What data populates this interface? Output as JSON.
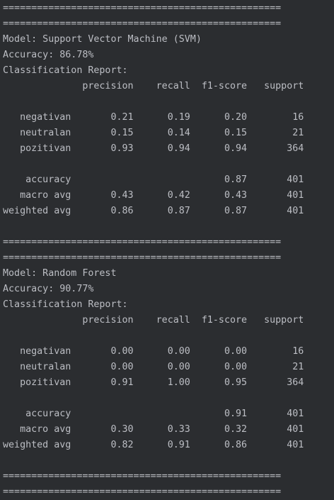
{
  "console": {
    "lines": [
      "=================================================",
      "=================================================",
      "Model: Support Vector Machine (SVM)",
      "Accuracy: 86.78%",
      "Classification Report:",
      "              precision    recall  f1-score   support",
      "",
      "   negativan       0.21      0.19      0.20        16",
      "   neutralan       0.15      0.14      0.15        21",
      "   pozitivan       0.93      0.94      0.94       364",
      "",
      "    accuracy                           0.87       401",
      "   macro avg       0.43      0.42      0.43       401",
      "weighted avg       0.86      0.87      0.87       401",
      "",
      "=================================================",
      "=================================================",
      "Model: Random Forest",
      "Accuracy: 90.77%",
      "Classification Report:",
      "              precision    recall  f1-score   support",
      "",
      "   negativan       0.00      0.00      0.00        16",
      "   neutralan       0.00      0.00      0.00        21",
      "   pozitivan       0.91      1.00      0.95       364",
      "",
      "    accuracy                           0.91       401",
      "   macro avg       0.30      0.33      0.32       401",
      "weighted avg       0.82      0.91      0.86       401",
      "",
      "=================================================",
      "================================================="
    ]
  },
  "colors": {
    "background": "#2b2d30",
    "text": "#bcbec4"
  }
}
